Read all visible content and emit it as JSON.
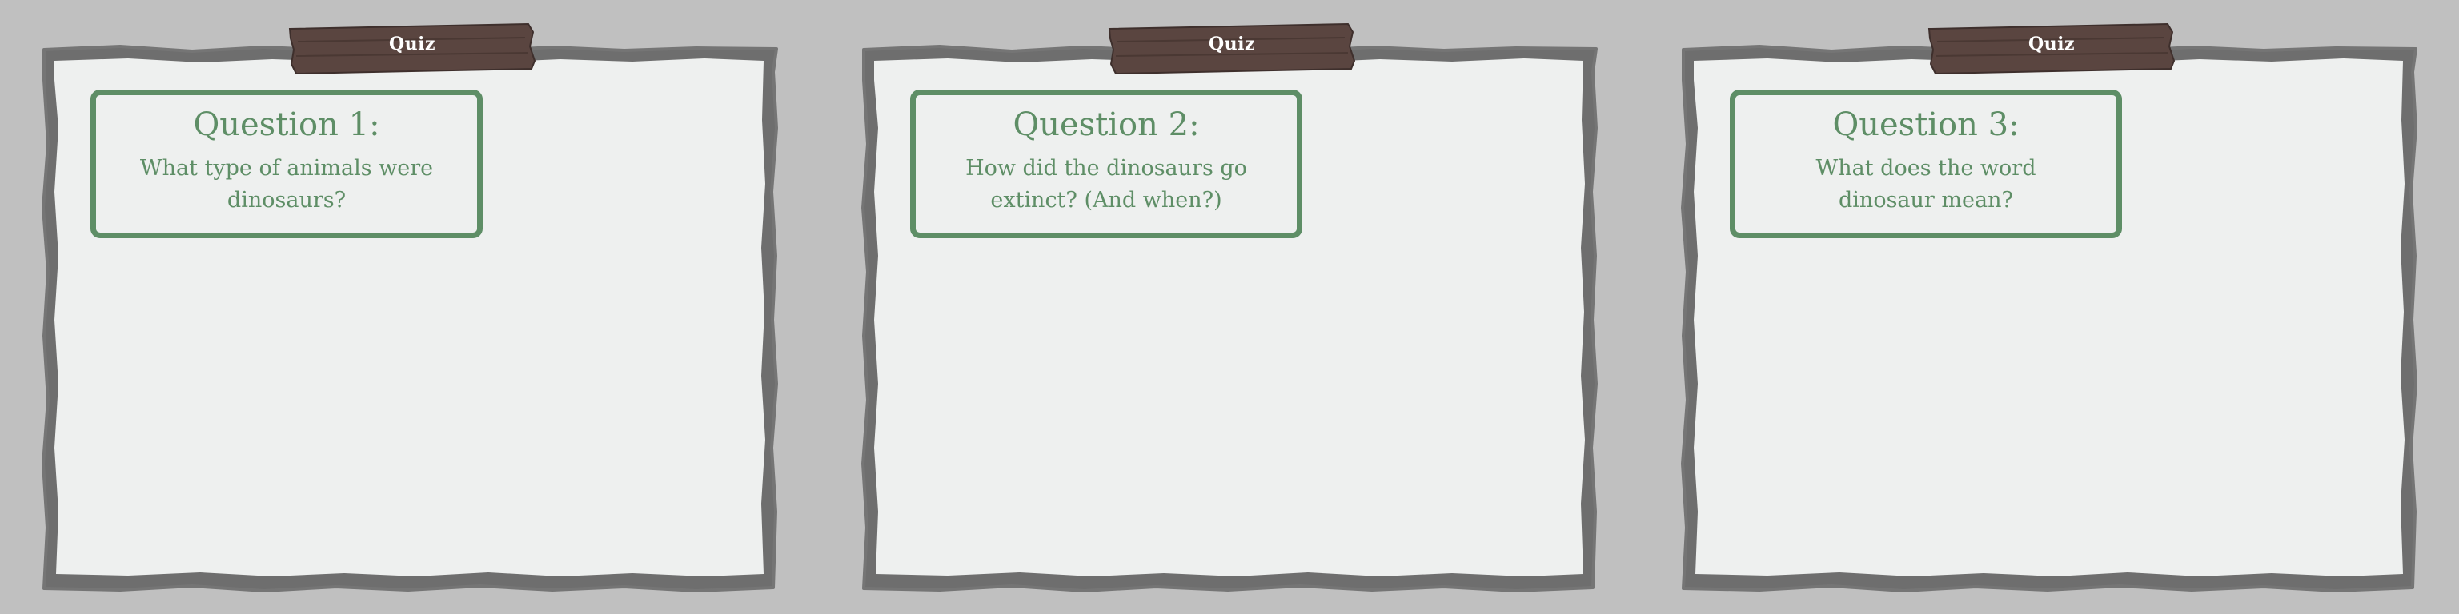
{
  "colors": {
    "background": "#c0c0c0",
    "paper": "#eef0ef",
    "frame": "#6e6e6e",
    "wood_tab": "#5a4540",
    "accent_green": "#5e8e66"
  },
  "slides": [
    {
      "tab_label": "Quiz",
      "question_title": "Question 1:",
      "question_text": "What type of animals were dinosaurs?"
    },
    {
      "tab_label": "Quiz",
      "question_title": "Question 2:",
      "question_text": "How did the dinosaurs go extinct? (And when?)"
    },
    {
      "tab_label": "Quiz",
      "question_title": "Question 3:",
      "question_text": "What does the word dinosaur mean?"
    }
  ]
}
